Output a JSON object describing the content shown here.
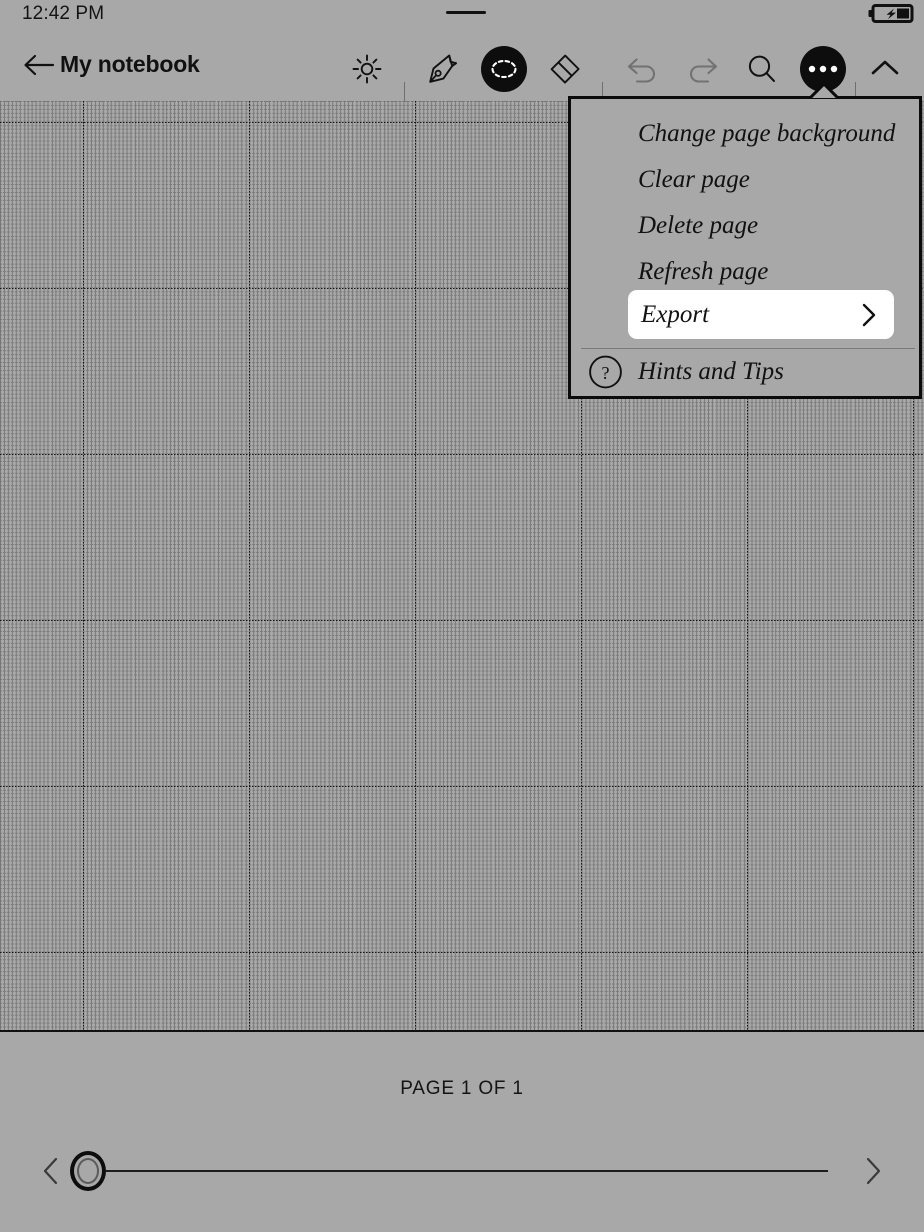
{
  "status_bar": {
    "clock": "12:42 PM",
    "notch_icon": "drag-handle-icon",
    "battery_icon": "battery-charging-icon"
  },
  "toolbar": {
    "back_icon": "arrow-left-icon",
    "title": "My notebook",
    "tools": [
      {
        "name": "brightness",
        "icon": "sun-icon",
        "selected": false,
        "disabled": false
      },
      {
        "name": "pen",
        "icon": "pen-nib-icon",
        "selected": false,
        "disabled": false
      },
      {
        "name": "selection",
        "icon": "lasso-select-icon",
        "selected": true,
        "disabled": false
      },
      {
        "name": "eraser",
        "icon": "eraser-icon",
        "selected": false,
        "disabled": false
      },
      {
        "name": "undo",
        "icon": "undo-arrow-icon",
        "selected": false,
        "disabled": true
      },
      {
        "name": "redo",
        "icon": "redo-arrow-icon",
        "selected": false,
        "disabled": true
      },
      {
        "name": "search",
        "icon": "magnifier-icon",
        "selected": false,
        "disabled": false
      },
      {
        "name": "more",
        "icon": "ellipsis-icon",
        "selected": true,
        "disabled": false
      },
      {
        "name": "collapse",
        "icon": "chevron-up-icon",
        "selected": false,
        "disabled": false
      }
    ]
  },
  "more_menu": {
    "open": true,
    "items": [
      {
        "label": "Change page background",
        "highlighted": false,
        "submenu": false,
        "icon": null
      },
      {
        "label": "Clear page",
        "highlighted": false,
        "submenu": false,
        "icon": null
      },
      {
        "label": "Delete page",
        "highlighted": false,
        "submenu": false,
        "icon": null
      },
      {
        "label": "Refresh page",
        "highlighted": false,
        "submenu": false,
        "icon": null
      },
      {
        "label": "Export",
        "highlighted": true,
        "submenu": true,
        "icon": null
      },
      {
        "label": "Hints and Tips",
        "highlighted": false,
        "submenu": false,
        "icon": "question-circle-icon"
      }
    ],
    "highlight_color": "#ffffff",
    "submenu_icon": "chevron-right-icon"
  },
  "canvas": {
    "background_template": "grid",
    "content": ""
  },
  "footer": {
    "page_indicator": "PAGE 1 OF 1",
    "prev_icon": "chevron-left-icon",
    "next_icon": "chevron-right-icon",
    "slider_value": 1,
    "slider_min": 1,
    "slider_max": 1
  },
  "colors": {
    "page_background": "#a8a8a8",
    "ink": "#111111",
    "accent": "#0d0d0d",
    "highlight": "#ffffff",
    "disabled": "#6d6d6d"
  }
}
